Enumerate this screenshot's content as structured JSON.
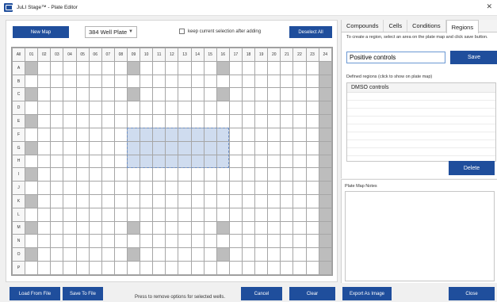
{
  "window": {
    "title": "JuLI Stage™ - Plate Editor"
  },
  "toolbar": {
    "new_map": "New Map",
    "plate_type": "384 Well Plate",
    "keep_selection": "keep current selection after adding",
    "deselect_all": "Deselect All"
  },
  "plate": {
    "corner": "All",
    "columns": [
      "01",
      "02",
      "03",
      "04",
      "05",
      "06",
      "07",
      "08",
      "09",
      "10",
      "11",
      "12",
      "13",
      "14",
      "15",
      "16",
      "17",
      "18",
      "19",
      "20",
      "21",
      "22",
      "23",
      "24"
    ],
    "rows": [
      "A",
      "B",
      "C",
      "D",
      "E",
      "F",
      "G",
      "H",
      "I",
      "J",
      "K",
      "L",
      "M",
      "N",
      "O",
      "P"
    ],
    "gray_wells": [
      "A1",
      "C1",
      "E1",
      "G1",
      "I1",
      "K1",
      "M1",
      "O1",
      "A9",
      "C9",
      "A16",
      "C16",
      "M9",
      "O9",
      "M16",
      "O16",
      "A24",
      "B24",
      "C24",
      "D24",
      "E24",
      "F24",
      "G24",
      "H24",
      "I24",
      "J24",
      "K24",
      "L24",
      "M24",
      "N24",
      "O24",
      "P24"
    ],
    "selected_rows": [
      "F",
      "G",
      "H"
    ],
    "selected_cols": [
      "09",
      "10",
      "11",
      "12",
      "13",
      "14",
      "15",
      "16"
    ]
  },
  "tabs": [
    "Compounds",
    "Cells",
    "Conditions",
    "Regions"
  ],
  "active_tab": "Regions",
  "regions": {
    "instructions": "To create a region, select an area on the plate map and click save button.",
    "name_value": "Positive controls",
    "save": "Save",
    "defined_label": "Defined regions (click to show on plate map)",
    "defined": [
      "DMSO controls"
    ],
    "delete": "Delete"
  },
  "notes": {
    "label": "Plate Map Notes",
    "value": ""
  },
  "footer": {
    "load": "Load From File",
    "save_file": "Save To File",
    "hint": "Press to remove options for selected wells.",
    "cancel": "Cancel",
    "clear": "Clear",
    "export": "Export As Image",
    "close": "Close"
  },
  "colors": {
    "accent": "#1f4e9c",
    "control_well": "#bdbdbd",
    "selection": "#cfdcef"
  }
}
